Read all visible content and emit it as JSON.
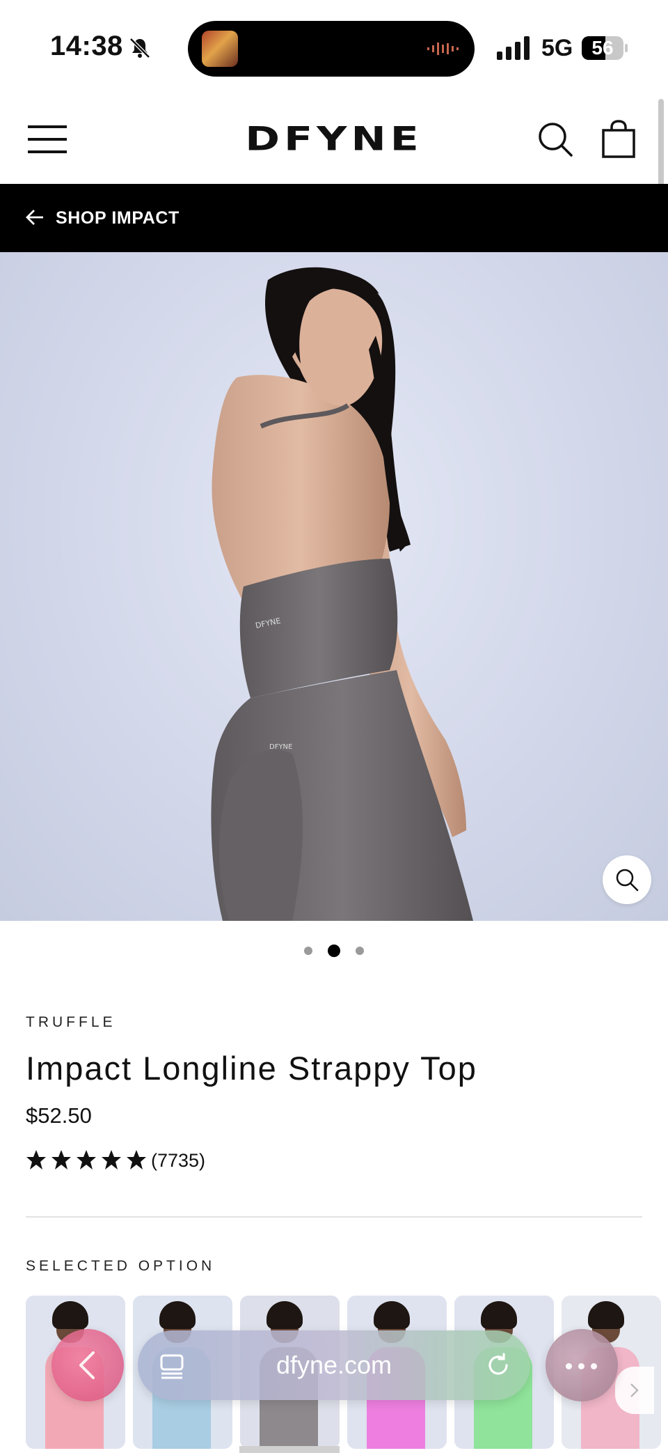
{
  "status_bar": {
    "time": "14:38",
    "network": "5G",
    "battery": "56",
    "battery_level": 0.56
  },
  "header": {
    "logo": "DFYNE",
    "menu_icon": "hamburger-menu-icon",
    "search_icon": "search-icon",
    "cart_icon": "shopping-bag-icon"
  },
  "shop_bar": {
    "label": "SHOP IMPACT",
    "icon": "arrow-left-icon"
  },
  "hero": {
    "image_alt": "Model wearing Impact Longline Strappy Top in truffle",
    "garment_print": "DFYNE",
    "background_color": "#d6dbed",
    "garment_color": "#6e6a6d",
    "zoom_icon": "zoom-icon",
    "slide_count": 3,
    "active_slide": 2
  },
  "product": {
    "variant": "TRUFFLE",
    "title": "Impact Longline Strappy Top",
    "price": "$52.50",
    "rating": 5,
    "review_count": "(7735)",
    "selected_option_label": "SELECTED OPTION"
  },
  "swatches": [
    {
      "color": "#f3a9b5",
      "bg": "#dfe3ef"
    },
    {
      "color": "#a9cde3",
      "bg": "#dde3ef"
    },
    {
      "color": "#8d898c",
      "bg": "#dde0ea"
    },
    {
      "color": "#ee7fe0",
      "bg": "#dfe3ef"
    },
    {
      "color": "#8fe39a",
      "bg": "#dfe3ef"
    },
    {
      "color": "#f1b6c8",
      "bg": "#e6e9f0"
    }
  ],
  "browser": {
    "url": "dfyne.com",
    "back_icon": "chevron-left-icon",
    "tabs_icon": "tabs-icon",
    "reload_icon": "reload-icon",
    "more_icon": "more-icon"
  }
}
